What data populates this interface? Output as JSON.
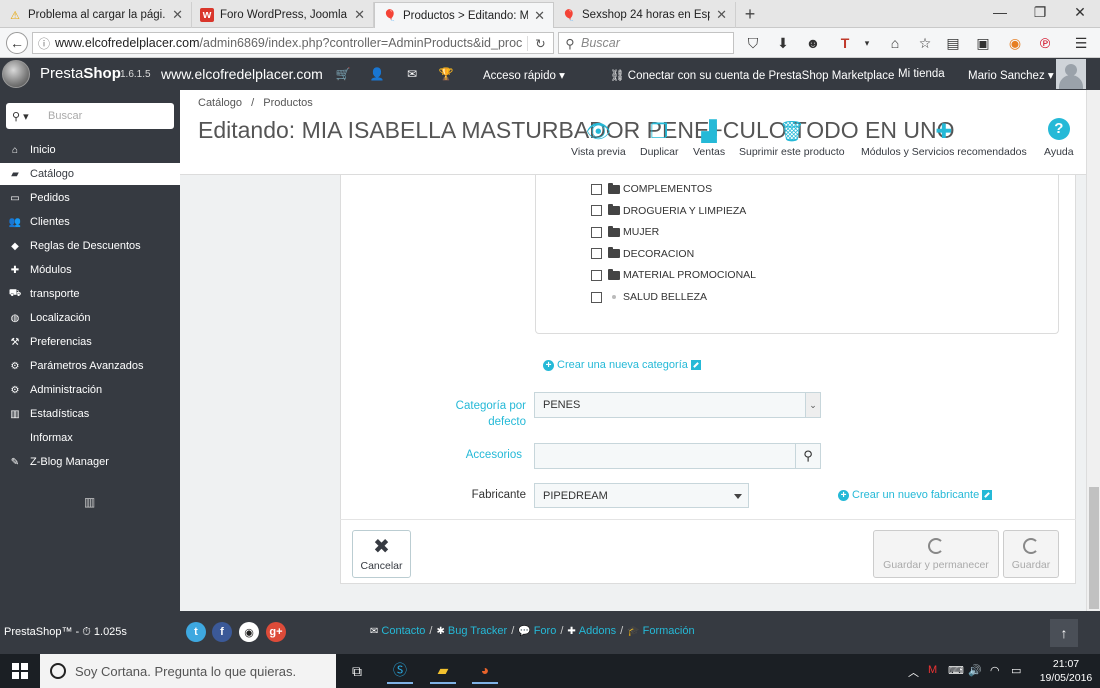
{
  "browser": {
    "tabs": [
      {
        "label": "Problema al cargar la pági...",
        "icon": "warning-icon"
      },
      {
        "label": "Foro WordPress, Joomla y ...",
        "icon": "w-logo-icon"
      },
      {
        "label": "Productos > Editando: Ml...",
        "icon": "prestashop-icon",
        "active": true
      },
      {
        "label": "Sexshop 24 horas en Espa...",
        "icon": "prestashop-icon"
      }
    ],
    "new_tab": "+",
    "url_host": "www.elcofredelplacer.com",
    "url_path": "/admin6869/index.php?controller=AdminProducts&id_proc",
    "search_placeholder": "Buscar"
  },
  "header": {
    "logo_presta": "Presta",
    "logo_shop": "Shop",
    "version": "1.6.1.5",
    "domain": "www.elcofredelplacer.com",
    "quick_access": "Acceso rápido ▾",
    "marketplace": "Conectar con su cuenta de PrestaShop Marketplace",
    "my_shop": "Mi tienda",
    "user": "Mario Sanchez ▾"
  },
  "sidebar": {
    "search_placeholder": "Buscar",
    "items": [
      {
        "label": "Inicio",
        "icon": "home-icon"
      },
      {
        "label": "Catálogo",
        "icon": "book-icon",
        "active": true
      },
      {
        "label": "Pedidos",
        "icon": "card-icon"
      },
      {
        "label": "Clientes",
        "icon": "users-icon"
      },
      {
        "label": "Reglas de Descuentos",
        "icon": "tag-icon"
      },
      {
        "label": "Módulos",
        "icon": "puzzle-icon"
      },
      {
        "label": "transporte",
        "icon": "truck-icon"
      },
      {
        "label": "Localización",
        "icon": "globe-icon"
      },
      {
        "label": "Preferencias",
        "icon": "wrench-icon"
      },
      {
        "label": "Parámetros Avanzados",
        "icon": "cogs-icon"
      },
      {
        "label": "Administración",
        "icon": "gear-icon"
      },
      {
        "label": "Estadísticas",
        "icon": "bar-chart-icon"
      },
      {
        "label": "Informax",
        "icon": ""
      },
      {
        "label": "Z-Blog Manager",
        "icon": "edit-icon"
      }
    ]
  },
  "page": {
    "breadcrumb_1": "Catálogo",
    "breadcrumb_sep": "/",
    "breadcrumb_2": "Productos",
    "title": "Editando: MIA ISABELLA MASTURBADOR PENE+CULO TODO EN UNO",
    "toolbar": [
      {
        "label": "Vista previa",
        "icon": "eye-icon"
      },
      {
        "label": "Duplicar",
        "icon": "copy-icon"
      },
      {
        "label": "Ventas",
        "icon": "stats-icon"
      },
      {
        "label": "Suprimir este producto",
        "icon": "trash-icon"
      },
      {
        "label": "Módulos y Servicios recomendados",
        "icon": "puzzle-icon"
      },
      {
        "label": "Ayuda",
        "icon": "help-icon"
      }
    ]
  },
  "categories": [
    {
      "label": "COMPLEMENTOS",
      "folder": true
    },
    {
      "label": "DROGUERIA Y LIMPIEZA",
      "folder": true
    },
    {
      "label": "MUJER",
      "folder": true
    },
    {
      "label": "DECORACION",
      "folder": true
    },
    {
      "label": "MATERIAL PROMOCIONAL",
      "folder": true
    },
    {
      "label": "SALUD BELLEZA",
      "folder": false
    }
  ],
  "form": {
    "new_category": "Crear una nueva categoría",
    "default_category_label_1": "Categoría por",
    "default_category_label_2": "defecto",
    "default_category_value": "PENES",
    "accessories_label": "Accesorios",
    "manufacturer_label": "Fabricante",
    "manufacturer_value": "PIPEDREAM",
    "new_manufacturer": "Crear un nuevo fabricante",
    "cancel": "Cancelar",
    "save_stay": "Guardar y permanecer",
    "save": "Guardar"
  },
  "footer": {
    "version_text": "PrestaShop™ - ⏱ 1.025s",
    "links": [
      "Contacto",
      "Bug Tracker",
      "Foro",
      "Addons",
      "Formación"
    ],
    "separator": "/"
  },
  "taskbar": {
    "cortana": "Soy Cortana. Pregunta lo que quieras.",
    "time": "21:07",
    "date": "19/05/2016"
  },
  "colors": {
    "accent": "#25b9d7",
    "dark": "#363a41"
  }
}
